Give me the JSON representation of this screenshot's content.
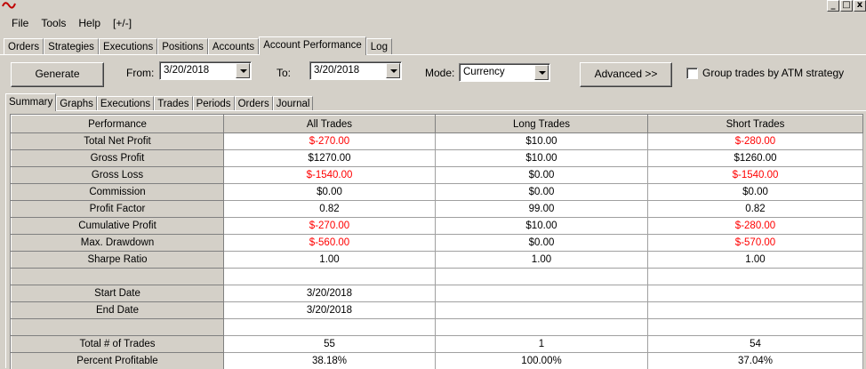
{
  "menu": {
    "items": [
      "File",
      "Tools",
      "Help",
      "[+/-]"
    ]
  },
  "window_buttons": {
    "minimize": "_",
    "restore": "□",
    "close": "x"
  },
  "main_tabs": [
    "Orders",
    "Strategies",
    "Executions",
    "Positions",
    "Accounts",
    "Account Performance",
    "Log"
  ],
  "main_tab_active": "Account Performance",
  "toolbar": {
    "generate_label": "Generate",
    "from_label": "From:",
    "from_value": "3/20/2018",
    "to_label": "To:",
    "to_value": "3/20/2018",
    "mode_label": "Mode:",
    "mode_value": "Currency",
    "advanced_label": "Advanced >>",
    "group_trades_label": "Group trades by ATM strategy",
    "group_trades_checked": false
  },
  "sub_tabs": [
    "Summary",
    "Graphs",
    "Executions",
    "Trades",
    "Periods",
    "Orders",
    "Journal"
  ],
  "sub_tab_active": "Summary",
  "colors": {
    "negative": "#ff0000",
    "chrome": "#d4d0c8",
    "logo": "#c00000"
  },
  "grid": {
    "columns": [
      "Performance",
      "All Trades",
      "Long Trades",
      "Short Trades"
    ],
    "rows": [
      {
        "label": "Total Net Profit",
        "all": "$-270.00",
        "long": "$10.00",
        "short": "$-280.00"
      },
      {
        "label": "Gross Profit",
        "all": "$1270.00",
        "long": "$10.00",
        "short": "$1260.00"
      },
      {
        "label": "Gross Loss",
        "all": "$-1540.00",
        "long": "$0.00",
        "short": "$-1540.00"
      },
      {
        "label": "Commission",
        "all": "$0.00",
        "long": "$0.00",
        "short": "$0.00"
      },
      {
        "label": "Profit Factor",
        "all": "0.82",
        "long": "99.00",
        "short": "0.82"
      },
      {
        "label": "Cumulative Profit",
        "all": "$-270.00",
        "long": "$10.00",
        "short": "$-280.00"
      },
      {
        "label": "Max. Drawdown",
        "all": "$-560.00",
        "long": "$0.00",
        "short": "$-570.00"
      },
      {
        "label": "Sharpe Ratio",
        "all": "1.00",
        "long": "1.00",
        "short": "1.00"
      },
      {
        "label": "",
        "all": "",
        "long": "",
        "short": ""
      },
      {
        "label": "Start Date",
        "all": "3/20/2018",
        "long": "",
        "short": ""
      },
      {
        "label": "End Date",
        "all": "3/20/2018",
        "long": "",
        "short": ""
      },
      {
        "label": "",
        "all": "",
        "long": "",
        "short": ""
      },
      {
        "label": "Total # of Trades",
        "all": "55",
        "long": "1",
        "short": "54"
      },
      {
        "label": "Percent Profitable",
        "all": "38.18%",
        "long": "100.00%",
        "short": "37.04%"
      }
    ]
  }
}
